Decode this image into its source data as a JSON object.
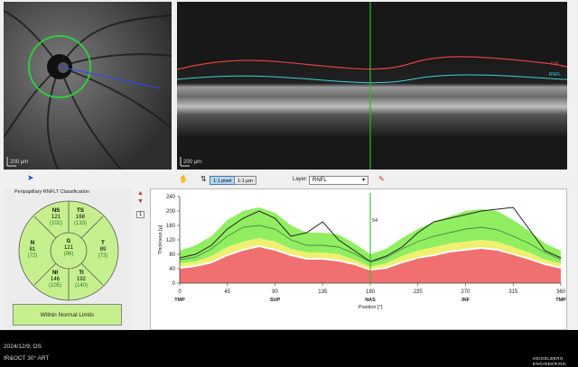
{
  "fundus": {
    "scale_label": "200 µm"
  },
  "oct": {
    "scale_label": "200 µm",
    "ilm_tag": "ILM",
    "rnfl_tag": "RNFL"
  },
  "toolbar": {
    "pixel_btn": "1:1 pixel",
    "um_btn": "1:1 µm",
    "layer_label": "Layer:",
    "layer_value": "RNFL"
  },
  "classification": {
    "title": "Peripapillary RNFLT Classification",
    "result": "Within Normal Limits",
    "page_badge": "1",
    "sectors": {
      "NS": {
        "name": "NS",
        "value": "121",
        "ref": "(102)"
      },
      "TS": {
        "name": "TS",
        "value": "168",
        "ref": "(133)"
      },
      "N": {
        "name": "N",
        "value": "81",
        "ref": "(72)"
      },
      "G": {
        "name": "G",
        "value": "121",
        "ref": "(96)"
      },
      "T": {
        "name": "T",
        "value": "89",
        "ref": "(73)"
      },
      "NI": {
        "name": "NI",
        "value": "146",
        "ref": "(105)"
      },
      "TI": {
        "name": "TI",
        "value": "192",
        "ref": "(140)"
      }
    }
  },
  "chart_data": {
    "type": "line",
    "ylabel": "Thickness [µ]",
    "xlabel": "Position [°]",
    "xlim": [
      0,
      360
    ],
    "ylim": [
      0,
      240
    ],
    "x_ticks": [
      0,
      45,
      90,
      135,
      180,
      225,
      270,
      315,
      360
    ],
    "y_ticks": [
      0,
      40,
      80,
      120,
      160,
      200,
      240
    ],
    "region_labels": [
      "TMP",
      "SUP",
      "NAS",
      "INF",
      "TMP"
    ],
    "region_positions": [
      0,
      90,
      180,
      270,
      360
    ],
    "cursor": {
      "x": 180,
      "label": "54"
    },
    "x": [
      0,
      15,
      30,
      45,
      60,
      75,
      90,
      105,
      120,
      135,
      150,
      165,
      180,
      195,
      210,
      225,
      240,
      255,
      270,
      285,
      300,
      315,
      330,
      345,
      360
    ],
    "series": [
      {
        "name": "RNFL thickness",
        "color": "#222222",
        "values": [
          70,
          80,
          105,
          150,
          180,
          200,
          180,
          130,
          140,
          170,
          120,
          90,
          60,
          75,
          100,
          140,
          170,
          180,
          190,
          200,
          205,
          210,
          150,
          90,
          70
        ]
      },
      {
        "name": "normal",
        "color": "#4a8a4a",
        "values": [
          65,
          72,
          95,
          130,
          155,
          160,
          150,
          120,
          105,
          105,
          100,
          82,
          58,
          70,
          95,
          115,
          130,
          140,
          150,
          155,
          148,
          130,
          110,
          85,
          65
        ]
      }
    ],
    "bands": {
      "green_upper": [
        90,
        105,
        130,
        175,
        200,
        210,
        195,
        160,
        140,
        140,
        135,
        110,
        80,
        95,
        125,
        150,
        170,
        185,
        200,
        205,
        200,
        175,
        145,
        110,
        90
      ],
      "green_lower": [
        55,
        60,
        75,
        100,
        115,
        125,
        115,
        95,
        85,
        85,
        80,
        65,
        45,
        55,
        75,
        90,
        100,
        110,
        115,
        120,
        115,
        100,
        85,
        65,
        55
      ],
      "yellow_lower": [
        45,
        50,
        60,
        80,
        95,
        105,
        95,
        80,
        70,
        70,
        65,
        55,
        38,
        45,
        60,
        72,
        80,
        90,
        95,
        100,
        95,
        82,
        70,
        55,
        45
      ],
      "red_upper": [
        40,
        45,
        55,
        75,
        90,
        100,
        90,
        75,
        65,
        65,
        60,
        50,
        35,
        40,
        55,
        68,
        75,
        85,
        90,
        95,
        90,
        78,
        65,
        50,
        40
      ]
    },
    "colors": {
      "green": "#90ee60",
      "yellow": "#f0f070",
      "red": "#f07070",
      "cursor": "#22bb22"
    }
  },
  "footer": {
    "date_eye": "2024/12/9, OS",
    "mode": "IR&OCT 30° ART",
    "brand_top": "HEIDELBERG",
    "brand_bottom": "ENGINEERING"
  }
}
